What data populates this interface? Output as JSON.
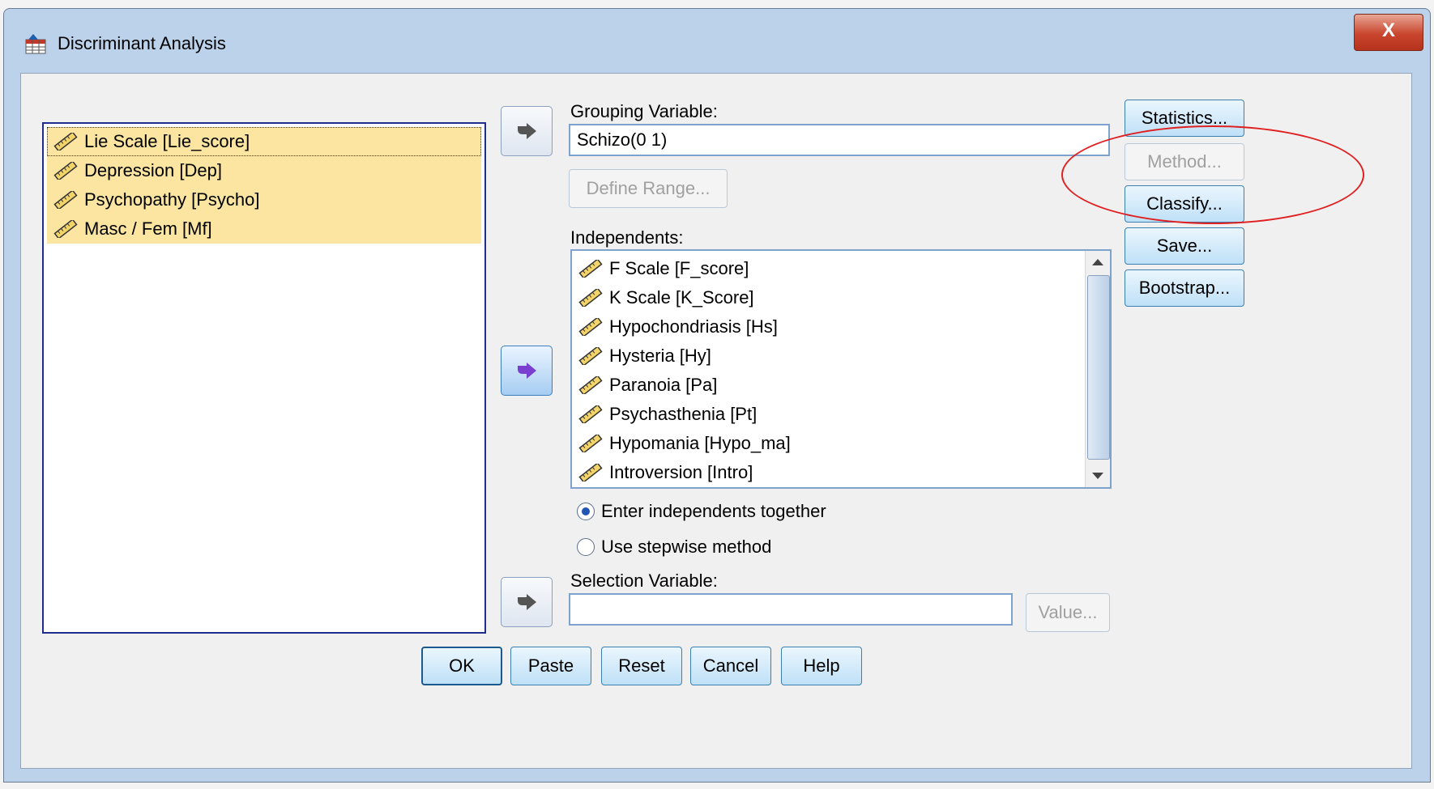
{
  "window": {
    "title": "Discriminant Analysis",
    "close_label": "X"
  },
  "source_variables": [
    {
      "label": "Lie Scale [Lie_score]"
    },
    {
      "label": "Depression [Dep]"
    },
    {
      "label": "Psychopathy [Psycho]"
    },
    {
      "label": "Masc / Fem [Mf]"
    }
  ],
  "grouping": {
    "label": "Grouping Variable:",
    "value": "Schizo(0 1)",
    "define_range": "Define Range..."
  },
  "independents": {
    "label": "Independents:",
    "items": [
      "F Scale [F_score]",
      "K Scale [K_Score]",
      "Hypochondriasis [Hs]",
      "Hysteria [Hy]",
      "Paranoia [Pa]",
      "Psychasthenia [Pt]",
      "Hypomania [Hypo_ma]",
      "Introversion [Intro]"
    ]
  },
  "method": {
    "enter_together": "Enter independents together",
    "stepwise": "Use stepwise method",
    "selected": "enter_together"
  },
  "selection": {
    "label": "Selection Variable:",
    "value": "",
    "value_button": "Value..."
  },
  "side_buttons": {
    "statistics": "Statistics...",
    "method": "Method...",
    "classify": "Classify...",
    "save": "Save...",
    "bootstrap": "Bootstrap..."
  },
  "bottom_buttons": {
    "ok": "OK",
    "paste": "Paste",
    "reset": "Reset",
    "cancel": "Cancel",
    "help": "Help"
  },
  "colors": {
    "selected_item": "#fbe5a1",
    "annotation": "#e02020",
    "list_border": "#1f2d8c"
  }
}
